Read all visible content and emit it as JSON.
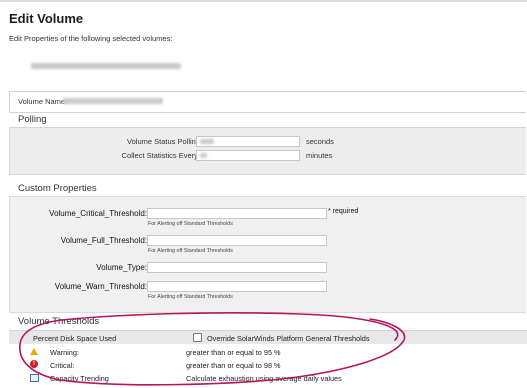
{
  "header": {
    "title": "Edit Volume",
    "subtitle": "Edit Properties of the following selected volumes:"
  },
  "volume": {
    "name_label": "Volume Name:"
  },
  "polling": {
    "title": "Polling",
    "status_label": "Volume Status Polling",
    "status_unit": "seconds",
    "stats_label": "Collect Statistics Every:",
    "stats_unit": "minutes"
  },
  "custom_properties": {
    "title": "Custom Properties",
    "hint": "For Alerting off Standard Thresholds",
    "required": "* required",
    "fields": [
      {
        "label": "Volume_Critical_Threshold:"
      },
      {
        "label": "Volume_Full_Threshold:"
      },
      {
        "label": "Volume_Type:"
      },
      {
        "label": "Volume_Warn_Threshold:"
      }
    ]
  },
  "thresholds": {
    "title": "Volume Thresholds",
    "metric_label": "Percent Disk Space Used",
    "override_label": "Override SolarWinds Platform General Thresholds",
    "override_checked": false,
    "rows": [
      {
        "icon": "warning-icon",
        "label": "Warning:",
        "value": "greater than or equal to 95 %"
      },
      {
        "icon": "critical-icon",
        "label": "Critical:",
        "value": "greater than or equal to 98 %"
      },
      {
        "icon": "chart-icon",
        "label": "Capacity Trending",
        "value": "Calculate exhaustion using average daily values"
      }
    ]
  },
  "colors": {
    "annotation": "#b5165e",
    "warning": "#e8a800",
    "critical": "#c62222"
  }
}
